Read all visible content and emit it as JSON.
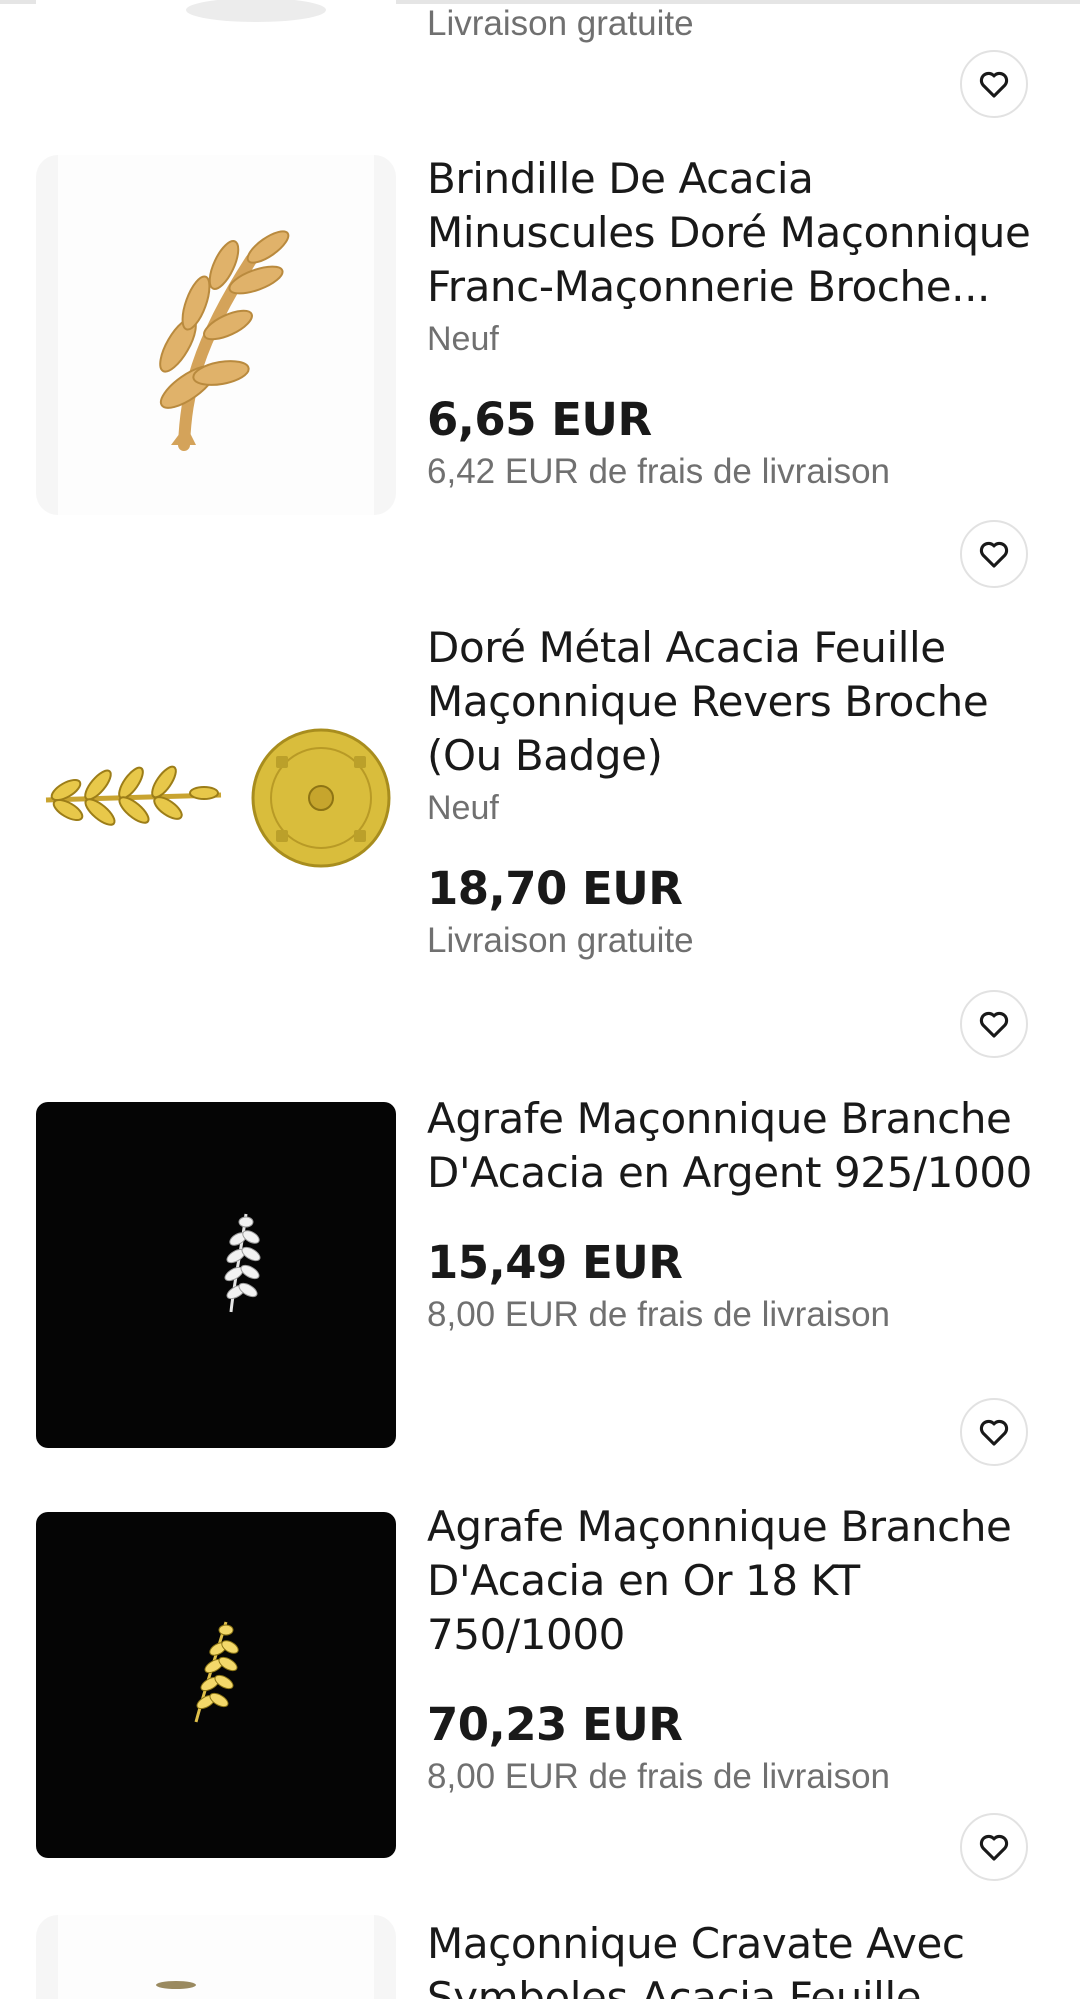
{
  "top_partial": {
    "shipping": "Livraison gratuite"
  },
  "listings": [
    {
      "title": "Brindille De Acacia Minuscules Doré Maçonnique Franc-Maçonnerie Broche...",
      "condition": "Neuf",
      "price": "6,65 EUR",
      "shipping": "6,42 EUR de frais de livraison",
      "image_icon": "gold-acacia-brooch-icon"
    },
    {
      "title": "Doré Métal Acacia Feuille Maçonnique Revers Broche (Ou Badge)",
      "condition": "Neuf",
      "price": "18,70 EUR",
      "shipping": "Livraison gratuite",
      "image_icon": "acacia-pin-with-clutch-icon"
    },
    {
      "title": "Agrafe Maçonnique Branche D'Acacia en Argent 925/1000",
      "price": "15,49 EUR",
      "shipping": "8,00 EUR de frais de livraison",
      "image_icon": "silver-acacia-pin-icon"
    },
    {
      "title": "Agrafe Maçonnique Branche D'Acacia en Or 18 KT 750/1000",
      "price": "70,23 EUR",
      "shipping": "8,00 EUR de frais de livraison",
      "image_icon": "gold-acacia-pin-icon"
    },
    {
      "title": "Maçonnique Cravate Avec Symboles Acacia Feuille"
    }
  ],
  "watch_icon": "heart-icon",
  "colors": {
    "text_primary": "#191919",
    "text_secondary": "#707070",
    "gold": "#d9a85a",
    "thumb_background": "#f6f6f6"
  }
}
